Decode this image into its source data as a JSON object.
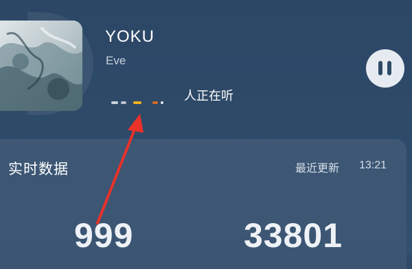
{
  "now_playing": {
    "title": "YOKU",
    "artist": "Eve",
    "listeners_label": "人正在听",
    "listeners_count_redacted": true
  },
  "controls": {
    "pause_icon": "pause-icon"
  },
  "realtime": {
    "section_title": "实时数据",
    "update_label": "最近更新",
    "update_time": "13:21",
    "stats": [
      "999",
      "33801"
    ]
  },
  "annotation": {
    "arrow_color": "#e8322a"
  },
  "colors": {
    "background": "#2f4a68",
    "card": "#3b5573",
    "pause_button": "#e6ebf1"
  }
}
